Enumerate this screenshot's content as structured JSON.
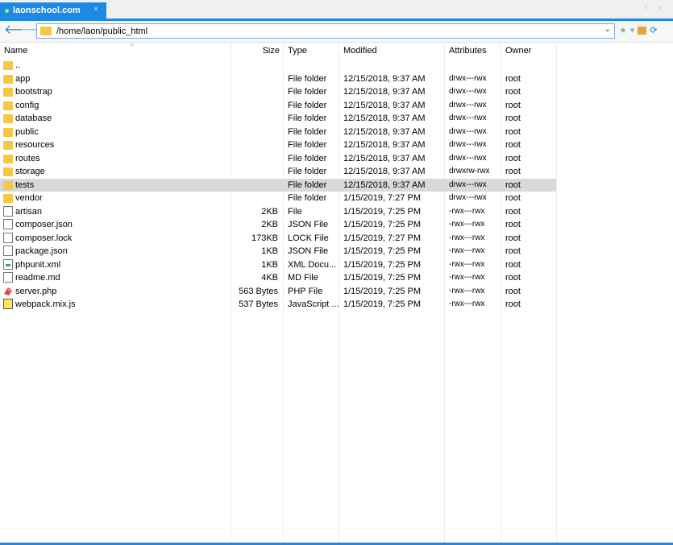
{
  "tab": {
    "title": "laonschool.com",
    "close": "×"
  },
  "nav": {
    "scroll_arrows": "‹ ›"
  },
  "toolbar": {
    "path": "/home/laon/public_html",
    "dropdown": "⌄"
  },
  "columns": {
    "name": "Name",
    "size": "Size",
    "type": "Type",
    "modified": "Modified",
    "attributes": "Attributes",
    "owner": "Owner"
  },
  "files": [
    {
      "icon": "folder",
      "name": "..",
      "size": "",
      "type": "",
      "modified": "",
      "attributes": "",
      "owner": ""
    },
    {
      "icon": "folder",
      "name": "app",
      "size": "",
      "type": "File folder",
      "modified": "12/15/2018, 9:37 AM",
      "attributes": "drwx---rwx",
      "owner": "root"
    },
    {
      "icon": "folder",
      "name": "bootstrap",
      "size": "",
      "type": "File folder",
      "modified": "12/15/2018, 9:37 AM",
      "attributes": "drwx---rwx",
      "owner": "root"
    },
    {
      "icon": "folder",
      "name": "config",
      "size": "",
      "type": "File folder",
      "modified": "12/15/2018, 9:37 AM",
      "attributes": "drwx---rwx",
      "owner": "root"
    },
    {
      "icon": "folder",
      "name": "database",
      "size": "",
      "type": "File folder",
      "modified": "12/15/2018, 9:37 AM",
      "attributes": "drwx---rwx",
      "owner": "root"
    },
    {
      "icon": "folder",
      "name": "public",
      "size": "",
      "type": "File folder",
      "modified": "12/15/2018, 9:37 AM",
      "attributes": "drwx---rwx",
      "owner": "root"
    },
    {
      "icon": "folder",
      "name": "resources",
      "size": "",
      "type": "File folder",
      "modified": "12/15/2018, 9:37 AM",
      "attributes": "drwx---rwx",
      "owner": "root"
    },
    {
      "icon": "folder",
      "name": "routes",
      "size": "",
      "type": "File folder",
      "modified": "12/15/2018, 9:37 AM",
      "attributes": "drwx---rwx",
      "owner": "root"
    },
    {
      "icon": "folder",
      "name": "storage",
      "size": "",
      "type": "File folder",
      "modified": "12/15/2018, 9:37 AM",
      "attributes": "drwxrw-rwx",
      "owner": "root"
    },
    {
      "icon": "folder",
      "name": "tests",
      "size": "",
      "type": "File folder",
      "modified": "12/15/2018, 9:37 AM",
      "attributes": "drwx---rwx",
      "owner": "root",
      "selected": true
    },
    {
      "icon": "folder",
      "name": "vendor",
      "size": "",
      "type": "File folder",
      "modified": "1/15/2019, 7:27 PM",
      "attributes": "drwx---rwx",
      "owner": "root"
    },
    {
      "icon": "file",
      "name": "artisan",
      "size": "2KB",
      "type": "File",
      "modified": "1/15/2019, 7:25 PM",
      "attributes": "-rwx---rwx",
      "owner": "root"
    },
    {
      "icon": "file",
      "name": "composer.json",
      "size": "2KB",
      "type": "JSON File",
      "modified": "1/15/2019, 7:25 PM",
      "attributes": "-rwx---rwx",
      "owner": "root"
    },
    {
      "icon": "file",
      "name": "composer.lock",
      "size": "173KB",
      "type": "LOCK File",
      "modified": "1/15/2019, 7:27 PM",
      "attributes": "-rwx---rwx",
      "owner": "root"
    },
    {
      "icon": "file",
      "name": "package.json",
      "size": "1KB",
      "type": "JSON File",
      "modified": "1/15/2019, 7:25 PM",
      "attributes": "-rwx---rwx",
      "owner": "root"
    },
    {
      "icon": "xml",
      "name": "phpunit.xml",
      "size": "1KB",
      "type": "XML Docu...",
      "modified": "1/15/2019, 7:25 PM",
      "attributes": "-rwx---rwx",
      "owner": "root"
    },
    {
      "icon": "file",
      "name": "readme.md",
      "size": "4KB",
      "type": "MD File",
      "modified": "1/15/2019, 7:25 PM",
      "attributes": "-rwx---rwx",
      "owner": "root"
    },
    {
      "icon": "php",
      "name": "server.php",
      "size": "563 Bytes",
      "type": "PHP File",
      "modified": "1/15/2019, 7:25 PM",
      "attributes": "-rwx---rwx",
      "owner": "root"
    },
    {
      "icon": "js",
      "name": "webpack.mix.js",
      "size": "537 Bytes",
      "type": "JavaScript ...",
      "modified": "1/15/2019, 7:25 PM",
      "attributes": "-rwx---rwx",
      "owner": "root"
    }
  ]
}
